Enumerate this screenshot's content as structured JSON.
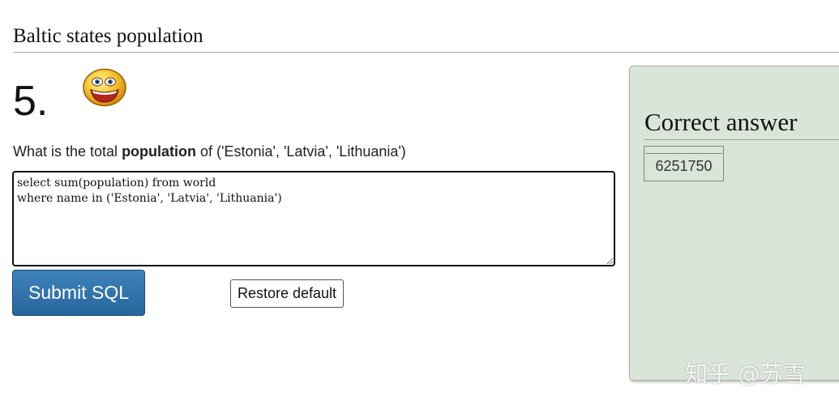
{
  "page": {
    "title": "Baltic states population"
  },
  "question": {
    "number": "5.",
    "text_before": "What is the total ",
    "text_bold": "population",
    "text_after": " of ('Estonia', 'Latvia', 'Lithuania')",
    "icon": "smiley-face-icon"
  },
  "editor": {
    "sql": "select sum(population) from world\nwhere name in ('Estonia', 'Latvia', 'Lithuania')"
  },
  "buttons": {
    "submit_label": "Submit SQL",
    "restore_label": "Restore default"
  },
  "answer": {
    "heading": "Correct answer",
    "value": "6251750"
  },
  "watermark": {
    "text": "知乎 @苏雪"
  },
  "colors": {
    "submit_button": "#2f6fa8",
    "answer_panel": "#dae5da"
  }
}
